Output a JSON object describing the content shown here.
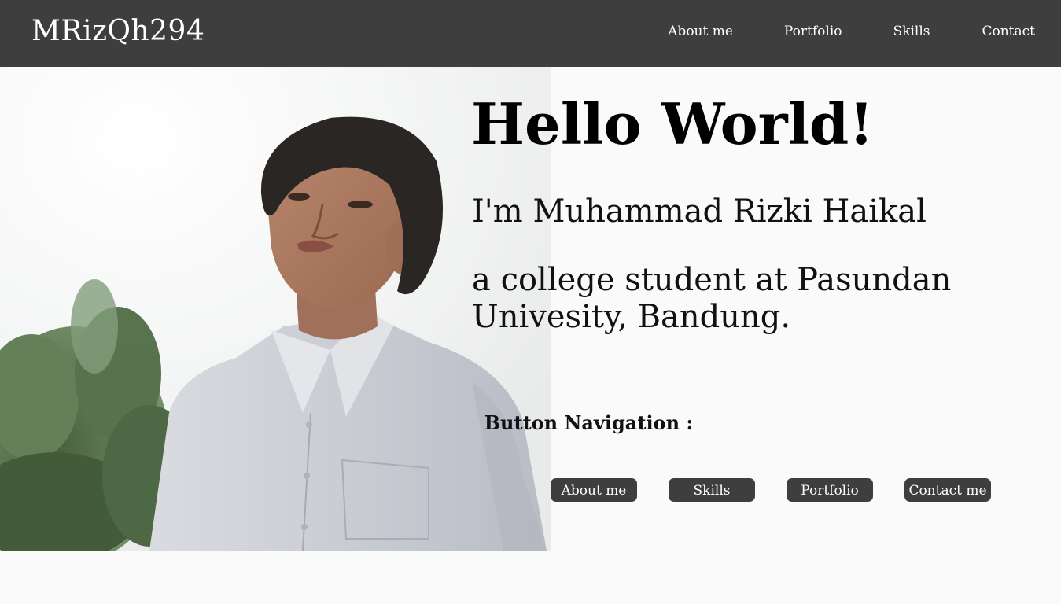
{
  "navbar": {
    "brand": "MRizQh294",
    "links": [
      "About me",
      "Portfolio",
      "Skills",
      "Contact"
    ]
  },
  "hero": {
    "heading": "Hello World!",
    "name_line": "I'm Muhammad Rizki Haikal",
    "description": "a college student at Pasundan Univesity, Bandung.",
    "photo_icon": "portrait-photo"
  },
  "button_nav": {
    "title": "Button Navigation :",
    "buttons": [
      "About me",
      "Skills",
      "Portfolio",
      "Contact me"
    ]
  },
  "colors": {
    "navbar_bg": "#3e3e3e",
    "page_bg": "#fafafa",
    "button_bg": "#3e3e3e",
    "text": "#000000"
  }
}
